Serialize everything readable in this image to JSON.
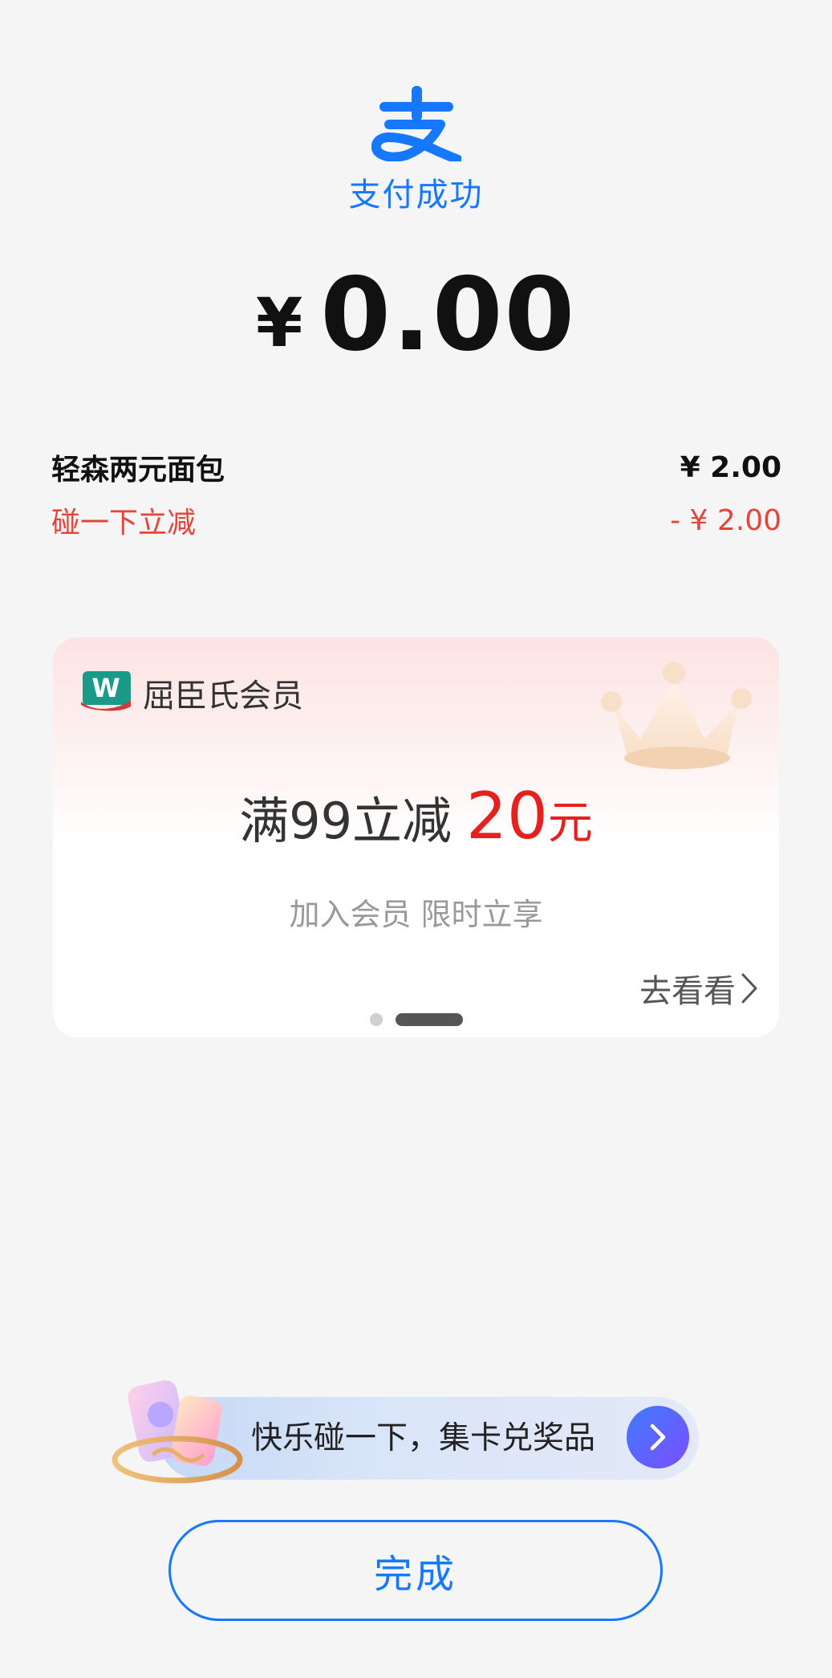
{
  "header": {
    "logo_icon": "alipay-logo-icon",
    "status": "支付成功",
    "accent_color": "#1677ff"
  },
  "payment": {
    "currency": "¥",
    "amount": "0.00"
  },
  "items": [
    {
      "label": "轻森两元面包",
      "value": "¥ 2.00"
    },
    {
      "label": "碰一下立减",
      "value": "- ¥ 2.00",
      "color": "#e8433a"
    }
  ],
  "promo": {
    "brand_icon": "watsons-w-logo-icon",
    "brand": "屈臣氏会员",
    "decoration_icon": "crown-icon",
    "offer_main": "满99立减",
    "offer_amount": "20",
    "offer_unit": "元",
    "offer_color": "#e4211f",
    "subtitle": "加入会员 限时立享",
    "link": "去看看",
    "link_icon": "chevron-right-icon",
    "carousel_pages": 2,
    "carousel_active": 2
  },
  "activity": {
    "text": "快乐碰一下，集卡兑奖品",
    "arrow_icon": "chevron-right-icon",
    "decoration_icon": "card-collection-icon"
  },
  "done_button": "完成"
}
